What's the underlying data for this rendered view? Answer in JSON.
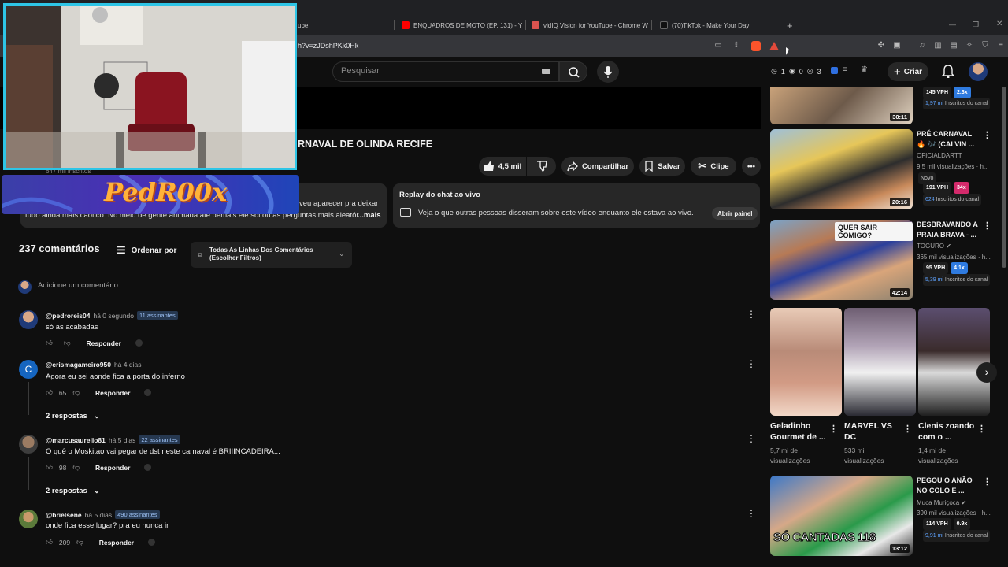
{
  "browser": {
    "tabs": [
      {
        "label": "ube",
        "color": "#ff0000"
      },
      {
        "label": "ENQUADROS DE MOTO (EP. 131) - Y",
        "color": "#ff0000"
      },
      {
        "label": "vidIQ Vision for YouTube - Chrome W",
        "color": "#d9534f"
      },
      {
        "label": "(70)TikTok - Make Your Day",
        "color": "#111111"
      }
    ],
    "new_tab": "+",
    "url": "h?v=zJDshPKk0Hk"
  },
  "youtube": {
    "search_placeholder": "Pesquisar",
    "stats": {
      "a": "1",
      "b": "0",
      "c": "3"
    },
    "create_label": "Criar"
  },
  "video": {
    "title": "RNAVAL DE OLINDA RECIFE",
    "channel_subs": "647 mil inscritos",
    "likes": "4,5 mil",
    "share": "Compartilhar",
    "save": "Salvar",
    "clip": "Clipe",
    "desc_line1": "veu aparecer pra deixar",
    "desc_line2": "tudo ainda mais caótico. No meio de gente animada até demais ele soltou as perguntas mais aleatór",
    "desc_more": "...mais",
    "chat_title": "Replay do chat ao vivo",
    "chat_text": "Veja o que outras pessoas disseram sobre este vídeo enquanto ele estava ao vivo.",
    "chat_button": "Abrir painel"
  },
  "comments": {
    "count": "237 comentários",
    "sort": "Ordenar por",
    "filter": "Todas As Linhas Dos Comentários (Escolher Filtros)",
    "add_placeholder": "Adicione um comentário...",
    "reply_label": "Responder",
    "items": [
      {
        "user": "@pedroreis04",
        "time": "há 0 segundo",
        "badge": "11 assinantes",
        "text": "só as acabadas",
        "likes": ""
      },
      {
        "user": "@crismagameiro950",
        "time": "há 4 dias",
        "badge": "",
        "text": "Agora eu sei aonde fica a porta do inferno",
        "likes": "65",
        "replies": "2 respostas",
        "avatar_letter": "C"
      },
      {
        "user": "@marcusaurelio81",
        "time": "há 5 dias",
        "badge": "22 assinantes",
        "text": "O quê o Moskitao vai pegar de dst neste carnaval é BRIIINCADEIRA...",
        "likes": "98",
        "replies": "2 respostas"
      },
      {
        "user": "@brielsene",
        "time": "há 5 dias",
        "badge": "490 assinantes",
        "text": "onde fica esse lugar? pra eu nunca ir",
        "likes": "209"
      }
    ]
  },
  "sidebar": {
    "top": {
      "vph": "145 VPH",
      "ratio": "2.3x",
      "subs_num": "1,97 mi",
      "subs_label": "Inscritos do canal",
      "duration": "30:11"
    },
    "videos": [
      {
        "title1": "PRÉ CARNAVAL",
        "title2": "🔥 🎶 (CALVIN ...",
        "channel": "OFICIALDARTT",
        "views": "9,5 mil visualizações · h...",
        "new_label": "Novo",
        "vph": "191 VPH",
        "ratio": "34x",
        "ratio_color": "#d42a6b",
        "subs_num": "624",
        "subs_label": "Inscritos do canal",
        "duration": "20:16"
      },
      {
        "title1": "DESBRAVANDO A",
        "title2": "PRAIA BRAVA - ...",
        "channel": "TOGURO",
        "views": "365 mil visualizações · h...",
        "vph": "95 VPH",
        "ratio": "4.1x",
        "ratio_color": "#2f7be0",
        "subs_num": "5,39 mi",
        "subs_label": "Inscritos do canal",
        "duration": "42:14",
        "thumb_text": "QUER SAIR COMIGO?"
      },
      {
        "title1": "PEGOU O ANÃO",
        "title2": "NO COLO E ...",
        "channel": "Muca Muriçoca",
        "views": "390 mil visualizações · h...",
        "vph": "114 VPH",
        "ratio": "0.9x",
        "ratio_color": "#1d1d1d",
        "subs_num": "9,91 mi",
        "subs_label": "Inscritos do canal",
        "duration": "13:12",
        "thumb_text": "SÓ CANTADAS 118"
      }
    ],
    "shorts": [
      {
        "title1": "Geladinho",
        "title2": "Gourmet de ...",
        "views1": "5,7 mi de",
        "views2": "visualizações"
      },
      {
        "title1": "MARVEL VS",
        "title2": "DC",
        "views1": "533 mil",
        "views2": "visualizações"
      },
      {
        "title1": "Clenis zoando",
        "title2": "com o ...",
        "views1": "1,4 mi de",
        "views2": "visualizações"
      }
    ]
  },
  "overlay": {
    "logo_text": "PedR00x"
  }
}
